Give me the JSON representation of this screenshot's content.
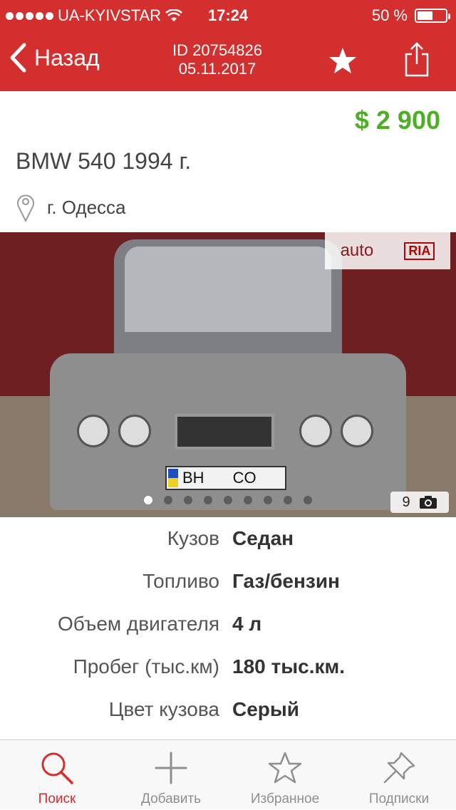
{
  "status_bar": {
    "carrier": "UA-KYIVSTAR",
    "time": "17:24",
    "battery": "50 %",
    "battery_level": 0.5
  },
  "nav": {
    "back_label": "Назад",
    "listing_id": "ID 20754826",
    "date": "05.11.2017",
    "favorite_icon": "star-icon",
    "share_icon": "share-icon"
  },
  "listing": {
    "price": "$ 2 900",
    "title": "BMW 540  1994 г.",
    "location": "г. Одесса"
  },
  "photo": {
    "watermark_auto": "auto",
    "watermark_ria": "RIA",
    "plate_left": "BH",
    "plate_right": "CO",
    "photo_count": "9",
    "dots_total": 9,
    "active_dot": 0
  },
  "specs": [
    {
      "label": "Кузов",
      "value": "Седан"
    },
    {
      "label": "Топливо",
      "value": "Газ/бензин"
    },
    {
      "label": "Объем двигателя",
      "value": "4 л"
    },
    {
      "label": "Пробег (тыс.км)",
      "value": "180 тыс.км."
    },
    {
      "label": "Цвет кузова",
      "value": "Серый"
    }
  ],
  "tabs": [
    {
      "label": "Поиск",
      "icon": "search-icon",
      "active": true
    },
    {
      "label": "Добавить",
      "icon": "plus-icon",
      "active": false
    },
    {
      "label": "Избранное",
      "icon": "star-icon",
      "active": false
    },
    {
      "label": "Подписки",
      "icon": "pin-icon",
      "active": false
    }
  ],
  "colors": {
    "accent_red": "#d32f2f",
    "price_green": "#4caf24"
  }
}
